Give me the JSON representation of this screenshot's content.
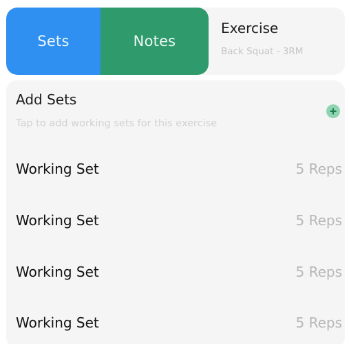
{
  "tabs": [
    {
      "label": "Sets"
    },
    {
      "label": "Notes"
    }
  ],
  "exercise": {
    "title": "Exercise",
    "subtitle": "Back Squat - 3RM"
  },
  "add_sets": {
    "title": "Add Sets",
    "hint": "Tap to add working sets for this exercise",
    "icon": "plus-circle-icon"
  },
  "sets": [
    {
      "label": "Working Set",
      "reps": "5 Reps"
    },
    {
      "label": "Working Set",
      "reps": "5 Reps"
    },
    {
      "label": "Working Set",
      "reps": "5 Reps"
    },
    {
      "label": "Working Set",
      "reps": "5 Reps"
    }
  ],
  "colors": {
    "tab_sets": "#2f90f1",
    "tab_notes": "#2f9b6d",
    "card_bg": "#f5f5f5",
    "plus_icon": "#8fd4b0"
  }
}
